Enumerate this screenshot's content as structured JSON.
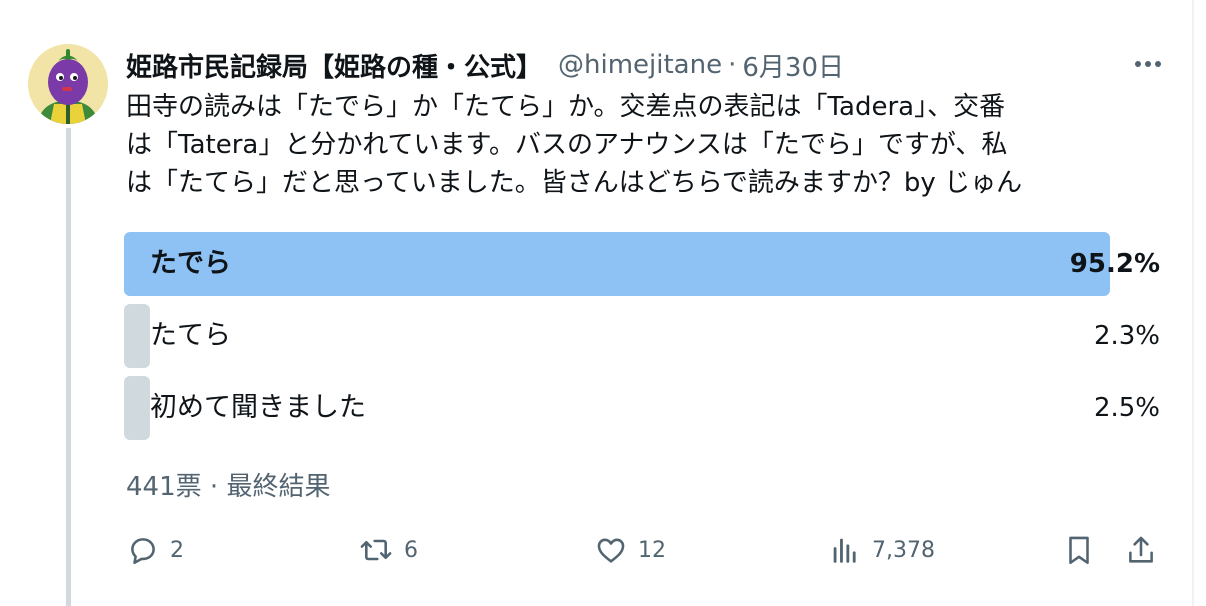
{
  "colors": {
    "text_primary": "#0f1419",
    "text_secondary": "#536471",
    "winner_bar": "#8ec2f5",
    "other_bar": "#cfd9de",
    "thread_line": "#cfd9de"
  },
  "tweet": {
    "display_name": "姫路市民記録局【姫路の種・公式】",
    "handle": "@himejitane",
    "separator": "·",
    "date": "6月30日",
    "more_icon": "more-horizontal-icon",
    "text_lines": [
      "田寺の読みは「たでら」か「たてら」か。交差点の表記は「Tadera」、交番",
      "は「Tatera」と分かれています。バスのアナウンスは「たでら」ですが、私",
      "は「たてら」だと思っていました。皆さんはどちらで読みますか？by じゅん"
    ]
  },
  "poll": {
    "options": [
      {
        "label": "たでら",
        "percent_label": "95.2%",
        "percent": 95.2,
        "winner": true
      },
      {
        "label": "たてら",
        "percent_label": "2.3%",
        "percent": 2.3,
        "winner": false
      },
      {
        "label": "初めて聞きました",
        "percent_label": "2.5%",
        "percent": 2.5,
        "winner": false
      }
    ],
    "votes": "441票",
    "separator": "·",
    "status": "最終結果"
  },
  "actions": {
    "reply": {
      "icon": "reply-icon",
      "count": "2"
    },
    "retweet": {
      "icon": "retweet-icon",
      "count": "6"
    },
    "like": {
      "icon": "heart-icon",
      "count": "12"
    },
    "views": {
      "icon": "views-chart-icon",
      "count": "7,378"
    },
    "bookmark": {
      "icon": "bookmark-icon"
    },
    "share": {
      "icon": "share-icon"
    }
  }
}
